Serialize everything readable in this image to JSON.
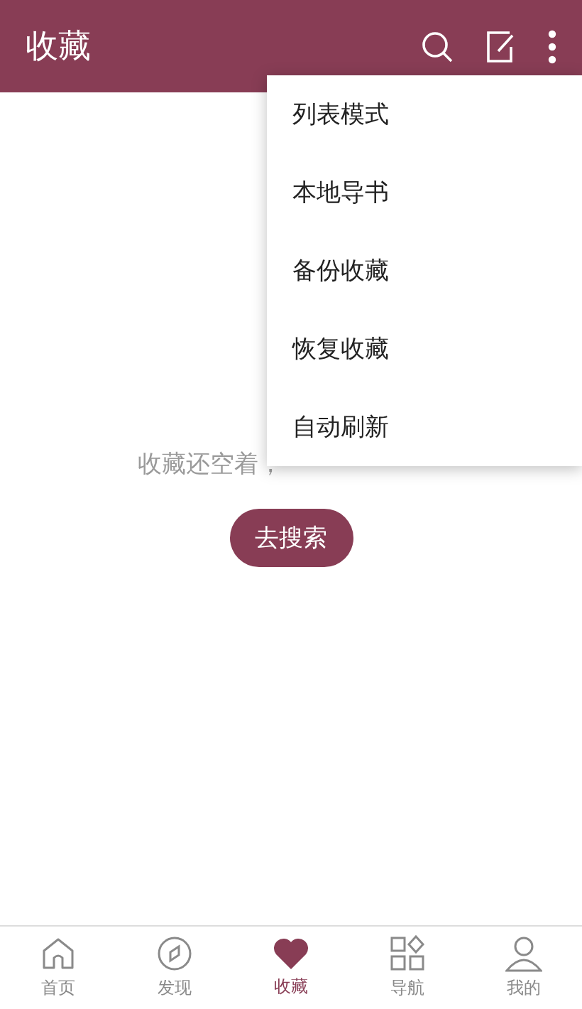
{
  "app_bar": {
    "title": "收藏"
  },
  "menu": {
    "items": [
      {
        "label": "列表模式"
      },
      {
        "label": "本地导书"
      },
      {
        "label": "备份收藏"
      },
      {
        "label": "恢复收藏"
      },
      {
        "label": "自动刷新"
      }
    ]
  },
  "empty_state": {
    "message": "收藏还空着，",
    "button": "去搜索"
  },
  "bottom_nav": [
    {
      "label": "首页",
      "kind": "home",
      "selected": false
    },
    {
      "label": "发现",
      "kind": "compass",
      "selected": false
    },
    {
      "label": "收藏",
      "kind": "heart",
      "selected": true
    },
    {
      "label": "导航",
      "kind": "grid",
      "selected": false
    },
    {
      "label": "我的",
      "kind": "person",
      "selected": false
    }
  ]
}
